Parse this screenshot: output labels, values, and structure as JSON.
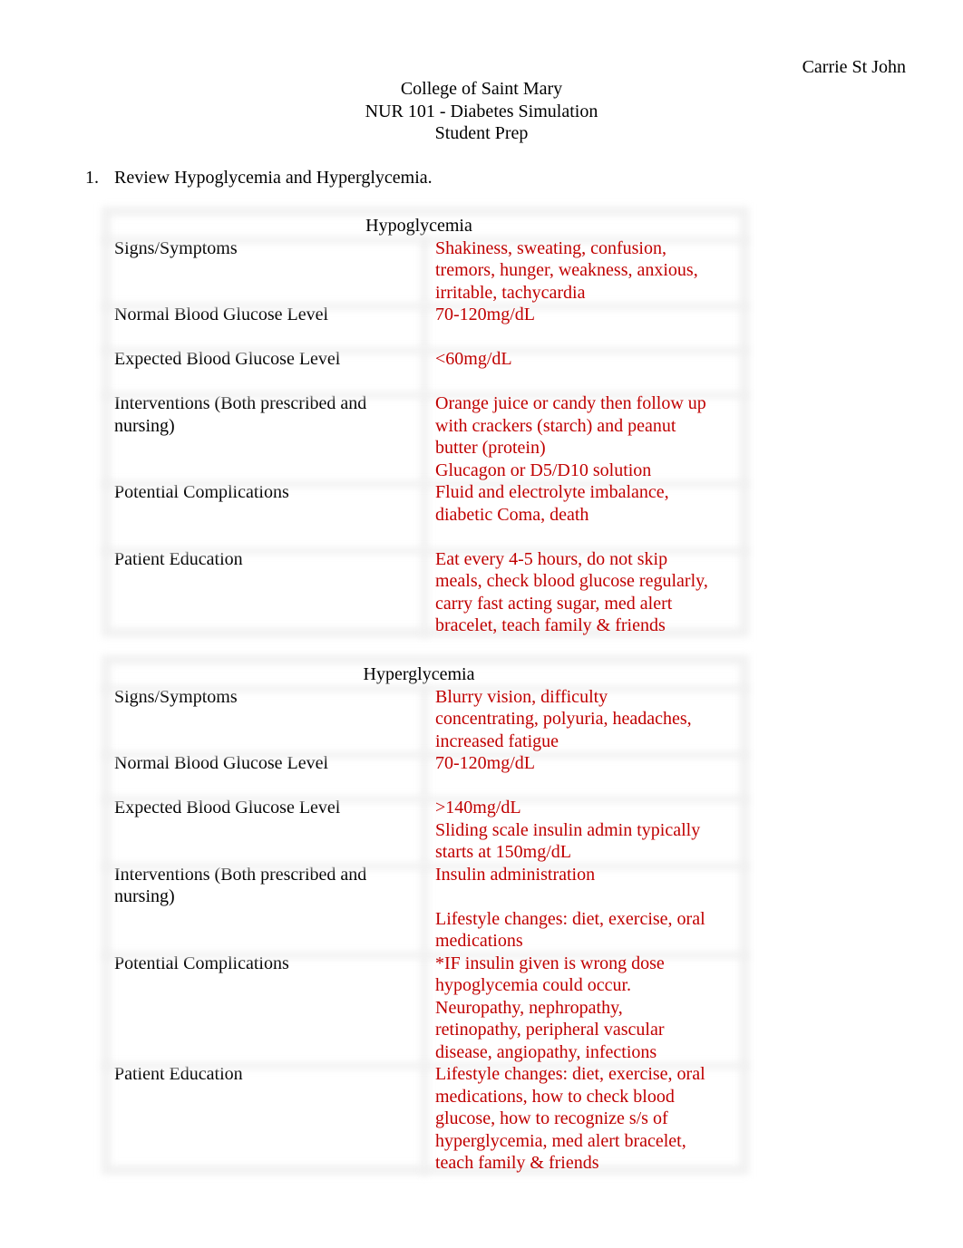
{
  "author": "Carrie St John",
  "header": {
    "line1": "College of Saint Mary",
    "line2": "NUR 101 - Diabetes Simulation",
    "line3": "Student Prep"
  },
  "task": {
    "number": "1.",
    "text": "Review Hypoglycemia and Hyperglycemia."
  },
  "colors": {
    "answer_text": "#c00000",
    "label_text": "#000000",
    "border": "#efefef"
  },
  "tables": {
    "hypo": {
      "title": "Hypoglycemia",
      "rows": [
        {
          "label": [
            "Signs/Symptoms"
          ],
          "value": [
            "Shakiness, sweating, confusion,",
            "tremors, hunger, weakness, anxious,",
            "irritable, tachycardia"
          ]
        },
        {
          "label": [
            "Normal Blood Glucose Level"
          ],
          "value": [
            "70-120mg/dL",
            ""
          ]
        },
        {
          "label": [
            "Expected Blood Glucose Level"
          ],
          "value": [
            "<60mg/dL",
            ""
          ]
        },
        {
          "label": [
            "Interventions (Both prescribed and",
            "nursing)"
          ],
          "value": [
            "Orange juice or candy then follow up",
            "with crackers (starch) and peanut",
            "butter (protein)",
            "Glucagon or D5/D10 solution"
          ]
        },
        {
          "label": [
            "Potential Complications"
          ],
          "value": [
            "Fluid and electrolyte imbalance,",
            "diabetic Coma, death",
            ""
          ]
        },
        {
          "label": [
            "Patient Education"
          ],
          "value": [
            "Eat every 4-5 hours, do not skip",
            "meals, check blood glucose regularly,",
            "carry fast acting sugar, med alert",
            "bracelet, teach family & friends"
          ]
        }
      ]
    },
    "hyper": {
      "title": "Hyperglycemia",
      "rows": [
        {
          "label": [
            "Signs/Symptoms"
          ],
          "value": [
            "Blurry vision, difficulty",
            "concentrating, polyuria, headaches,",
            "increased fatigue"
          ]
        },
        {
          "label": [
            "Normal Blood Glucose Level"
          ],
          "value": [
            "70-120mg/dL",
            ""
          ]
        },
        {
          "label": [
            "Expected Blood Glucose Level"
          ],
          "value": [
            ">140mg/dL",
            "Sliding scale insulin admin typically",
            "starts at 150mg/dL"
          ]
        },
        {
          "label": [
            "Interventions (Both prescribed and",
            "nursing)"
          ],
          "value": [
            "Insulin administration",
            "",
            "Lifestyle changes: diet, exercise, oral",
            "medications"
          ]
        },
        {
          "label": [
            "Potential Complications"
          ],
          "value": [
            "*IF insulin given is wrong dose",
            "hypoglycemia could occur.",
            "Neuropathy, nephropathy,",
            "retinopathy, peripheral vascular",
            "disease, angiopathy, infections"
          ]
        },
        {
          "label": [
            "Patient Education"
          ],
          "value": [
            "Lifestyle changes: diet, exercise, oral",
            "medications, how to check blood",
            "glucose, how to recognize s/s of",
            "hyperglycemia, med alert bracelet,",
            "teach family & friends"
          ]
        }
      ]
    }
  }
}
